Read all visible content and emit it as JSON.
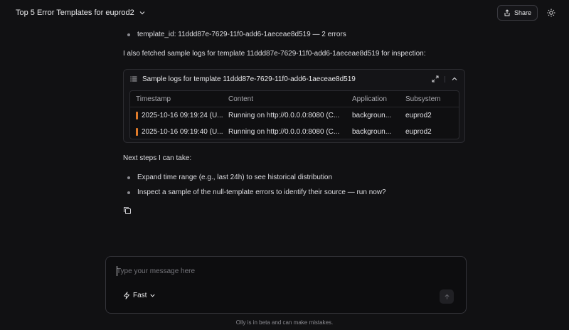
{
  "header": {
    "title": "Top 5 Error Templates for euprod2",
    "share_label": "Share"
  },
  "conversation": {
    "bullet_top": "template_id: 11ddd87e-7629-11f0-add6-1aeceae8d519 — 2 errors",
    "fetched_text": "I also fetched sample logs for template 11ddd87e-7629-11f0-add6-1aeceae8d519 for inspection:",
    "logs_card": {
      "title": "Sample logs for template 11ddd87e-7629-11f0-add6-1aeceae8d519",
      "columns": [
        "Timestamp",
        "Content",
        "Application",
        "Subsystem"
      ],
      "rows": [
        {
          "timestamp": "2025-10-16 09:19:24 (U...",
          "content": "Running on http://0.0.0.0:8080 (C...",
          "application": "backgroun...",
          "subsystem": "euprod2",
          "level_color": "#e07b2a"
        },
        {
          "timestamp": "2025-10-16 09:19:40 (U...",
          "content": "Running on http://0.0.0.0:8080 (C...",
          "application": "backgroun...",
          "subsystem": "euprod2",
          "level_color": "#e07b2a"
        }
      ]
    },
    "next_steps_label": "Next steps I can take:",
    "next_steps": [
      "Expand time range (e.g., last 24h) to see historical distribution",
      "Inspect a sample of the null-template errors to identify their source — run now?"
    ]
  },
  "composer": {
    "placeholder": "Type your message here",
    "model_label": "Fast"
  },
  "footer": {
    "note": "Olly is in beta and can make mistakes."
  },
  "icons": {
    "share": "share-icon",
    "theme": "sun-icon",
    "list": "list-icon",
    "expand": "expand-icon",
    "collapse": "chevron-up-icon",
    "copy": "copy-icon",
    "model": "lightning-icon",
    "send": "arrow-up-icon"
  },
  "colors": {
    "background": "#111113",
    "accent_level": "#e07b2a"
  }
}
